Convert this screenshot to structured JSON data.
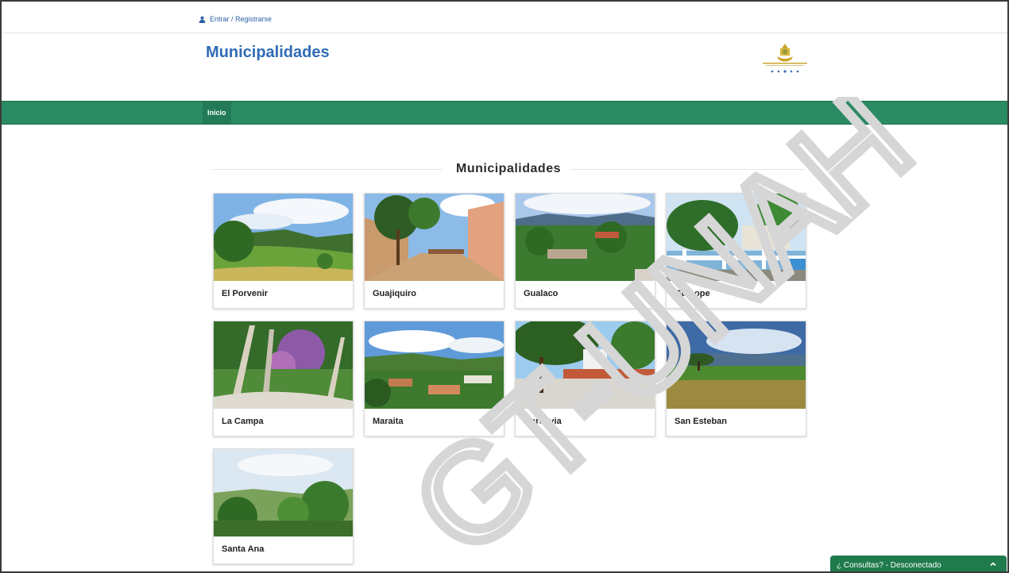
{
  "topbar": {
    "login_label": "Entrar / Registrarse",
    "user_icon": "user-icon"
  },
  "header": {
    "site_title": "Municipalidades",
    "seal_icon": "government-seal"
  },
  "navbar": {
    "items": [
      {
        "label": "Inicio"
      }
    ]
  },
  "main": {
    "section_title": "Municipalidades",
    "municipalities": [
      {
        "name": "El Porvenir"
      },
      {
        "name": "Guajiquiro"
      },
      {
        "name": "Gualaco"
      },
      {
        "name": "Guinope"
      },
      {
        "name": "La Campa"
      },
      {
        "name": "Maraita"
      },
      {
        "name": "Marcovia"
      },
      {
        "name": "San Esteban"
      },
      {
        "name": "Santa Ana"
      }
    ]
  },
  "chat": {
    "label": "¿ Consultas? - Desconectado",
    "chevron_icon": "chevron-up-icon"
  },
  "watermark": {
    "text": "GT-UNAH"
  },
  "colors": {
    "nav_green": "#2a8a63",
    "title_blue": "#2f6cb5",
    "chat_green": "#1f7a4c"
  }
}
